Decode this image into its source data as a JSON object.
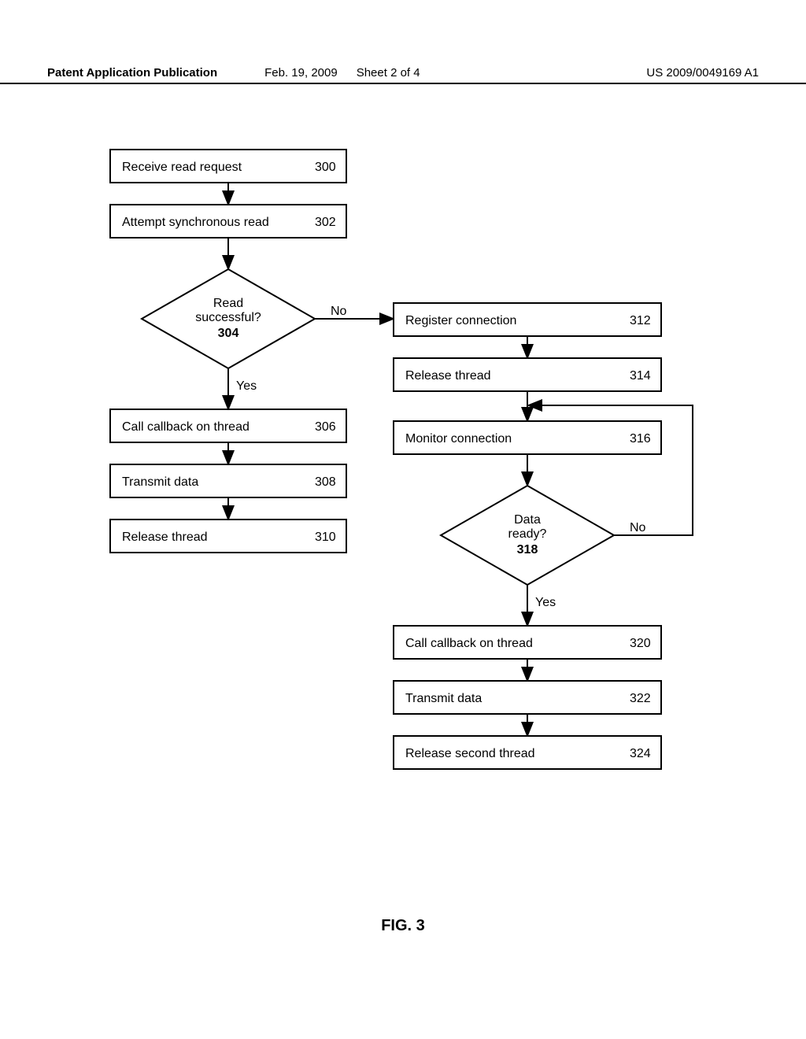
{
  "header": {
    "left": "Patent Application Publication",
    "date": "Feb. 19, 2009",
    "sheet": "Sheet 2 of 4",
    "pubno": "US 2009/0049169 A1"
  },
  "figure_label": "FIG. 3",
  "chart_data": {
    "type": "flowchart",
    "nodes": [
      {
        "id": "300",
        "type": "process",
        "label": "Receive read request",
        "ref": "300"
      },
      {
        "id": "302",
        "type": "process",
        "label": "Attempt synchronous read",
        "ref": "302"
      },
      {
        "id": "304",
        "type": "decision",
        "label": "Read successful?",
        "ref": "304"
      },
      {
        "id": "306",
        "type": "process",
        "label": "Call callback on thread",
        "ref": "306"
      },
      {
        "id": "308",
        "type": "process",
        "label": "Transmit data",
        "ref": "308"
      },
      {
        "id": "310",
        "type": "process",
        "label": "Release thread",
        "ref": "310"
      },
      {
        "id": "312",
        "type": "process",
        "label": "Register connection",
        "ref": "312"
      },
      {
        "id": "314",
        "type": "process",
        "label": "Release thread",
        "ref": "314"
      },
      {
        "id": "316",
        "type": "process",
        "label": "Monitor connection",
        "ref": "316"
      },
      {
        "id": "318",
        "type": "decision",
        "label": "Data ready?",
        "ref": "318"
      },
      {
        "id": "320",
        "type": "process",
        "label": "Call callback on thread",
        "ref": "320"
      },
      {
        "id": "322",
        "type": "process",
        "label": "Transmit data",
        "ref": "322"
      },
      {
        "id": "324",
        "type": "process",
        "label": "Release second thread",
        "ref": "324"
      }
    ],
    "edges": [
      {
        "from": "300",
        "to": "302"
      },
      {
        "from": "302",
        "to": "304"
      },
      {
        "from": "304",
        "to": "306",
        "label": "Yes"
      },
      {
        "from": "304",
        "to": "312",
        "label": "No"
      },
      {
        "from": "306",
        "to": "308"
      },
      {
        "from": "308",
        "to": "310"
      },
      {
        "from": "312",
        "to": "314"
      },
      {
        "from": "314",
        "to": "316"
      },
      {
        "from": "316",
        "to": "318"
      },
      {
        "from": "318",
        "to": "320",
        "label": "Yes"
      },
      {
        "from": "318",
        "to": "316",
        "label": "No"
      },
      {
        "from": "320",
        "to": "322"
      },
      {
        "from": "322",
        "to": "324"
      }
    ]
  },
  "labels": {
    "yes": "Yes",
    "no": "No"
  },
  "box": {
    "b300": {
      "text": "Receive read request",
      "num": "300"
    },
    "b302": {
      "text": "Attempt synchronous read",
      "num": "302"
    },
    "b306": {
      "text": "Call callback on thread",
      "num": "306"
    },
    "b308": {
      "text": "Transmit data",
      "num": "308"
    },
    "b310": {
      "text": "Release thread",
      "num": "310"
    },
    "b312": {
      "text": "Register connection",
      "num": "312"
    },
    "b314": {
      "text": "Release thread",
      "num": "314"
    },
    "b316": {
      "text": "Monitor connection",
      "num": "316"
    },
    "b320": {
      "text": "Call callback on thread",
      "num": "320"
    },
    "b322": {
      "text": "Transmit data",
      "num": "322"
    },
    "b324": {
      "text": "Release second thread",
      "num": "324"
    }
  },
  "diamond": {
    "d304": {
      "line1": "Read",
      "line2": "successful?",
      "num": "304"
    },
    "d318": {
      "line1": "Data",
      "line2": "ready?",
      "num": "318"
    }
  }
}
